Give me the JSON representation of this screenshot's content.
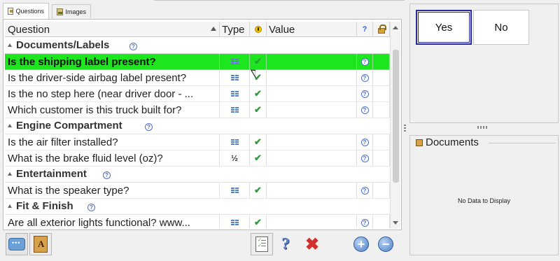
{
  "tabs": [
    {
      "label": "Questions",
      "active": true,
      "icon": "questions-tab-icon"
    },
    {
      "label": "Images",
      "active": false,
      "icon": "images-tab-icon"
    }
  ],
  "grid": {
    "columns": {
      "question": "Question",
      "type": "Type",
      "warning": "warning-icon",
      "value": "Value",
      "help": "help-icon",
      "lock": "lock-icon"
    },
    "groups": [
      {
        "title": "Documents/Labels",
        "rows": [
          {
            "question": "Is the shipping label present?",
            "type": "list",
            "check": true,
            "selected": true
          },
          {
            "question": "Is the driver-side airbag label present?",
            "type": "list",
            "check": true
          },
          {
            "question": "Is the no step here (near driver door - ...",
            "type": "list",
            "check": true
          },
          {
            "question": "Which customer is this truck built for?",
            "type": "list",
            "check": true
          }
        ]
      },
      {
        "title": "Engine Compartment",
        "rows": [
          {
            "question": "Is the air filter installed?",
            "type": "list",
            "check": true
          },
          {
            "question": "What is the brake fluid level (oz)?",
            "type": "fraction",
            "type_label": "½",
            "check": true
          }
        ]
      },
      {
        "title": "Entertainment",
        "rows": [
          {
            "question": "What is the speaker type?",
            "type": "list",
            "check": true
          }
        ]
      },
      {
        "title": "Fit & Finish",
        "rows": [
          {
            "question": "Are all exterior lights functional? www...",
            "type": "list",
            "check": true
          }
        ]
      }
    ]
  },
  "toolbar": {
    "left": [
      "comment-icon",
      "book-icon"
    ],
    "center": [
      "checklist-icon",
      "help-icon",
      "delete-icon"
    ],
    "right": [
      "add-icon",
      "remove-icon"
    ]
  },
  "answer": {
    "yes_label": "Yes",
    "no_label": "No",
    "selected": "Yes"
  },
  "documents": {
    "title": "Documents",
    "empty_text": "No Data to Display"
  },
  "colors": {
    "selected_row": "#1ee61e",
    "check": "#2f9a3a",
    "help": "#4f6fd0",
    "delete": "#d0312d"
  }
}
